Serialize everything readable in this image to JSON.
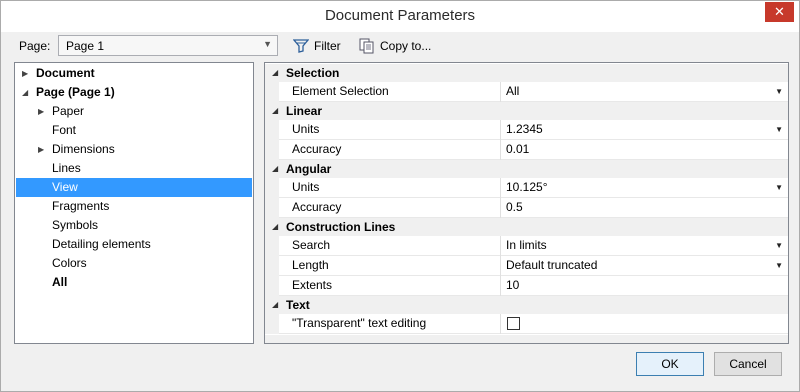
{
  "window": {
    "title": "Document Parameters",
    "close_symbol": "✕"
  },
  "toolbar": {
    "page_label": "Page:",
    "page_value": "Page 1",
    "filter_label": "Filter",
    "copy_label": "Copy to..."
  },
  "tree": [
    {
      "label": "Document",
      "bold": true,
      "expander": "▶"
    },
    {
      "label": "Page (Page 1)",
      "bold": true,
      "expander": "◢"
    },
    {
      "label": "Paper",
      "expander": "▶"
    },
    {
      "label": "Font"
    },
    {
      "label": "Dimensions",
      "expander": "▶"
    },
    {
      "label": "Lines"
    },
    {
      "label": "View",
      "selected": true
    },
    {
      "label": "Fragments"
    },
    {
      "label": "Symbols"
    },
    {
      "label": "Detailing elements"
    },
    {
      "label": "Colors"
    },
    {
      "label": "All",
      "bold": true
    }
  ],
  "grid": {
    "categories": [
      {
        "title": "Selection"
      },
      {
        "title": "Linear"
      },
      {
        "title": "Angular"
      },
      {
        "title": "Construction Lines"
      },
      {
        "title": "Text"
      }
    ],
    "properties": [
      {
        "name": "Element Selection",
        "value": "All",
        "dropdown": true
      },
      {
        "name": "Units",
        "value": "1.2345",
        "dropdown": true
      },
      {
        "name": "Accuracy",
        "value": "0.01"
      },
      {
        "name": "Units",
        "value": "10.125°",
        "dropdown": true
      },
      {
        "name": "Accuracy",
        "value": "0.5"
      },
      {
        "name": "Search",
        "value": "In limits",
        "dropdown": true
      },
      {
        "name": "Length",
        "value": "Default truncated",
        "dropdown": true
      },
      {
        "name": "Extents",
        "value": "10"
      },
      {
        "name": "\"Transparent\" text editing",
        "checkbox": true,
        "checked": false
      }
    ]
  },
  "buttons": {
    "ok": "OK",
    "cancel": "Cancel"
  },
  "colors": {
    "selection": "#3399ff",
    "close": "#c7392b"
  }
}
